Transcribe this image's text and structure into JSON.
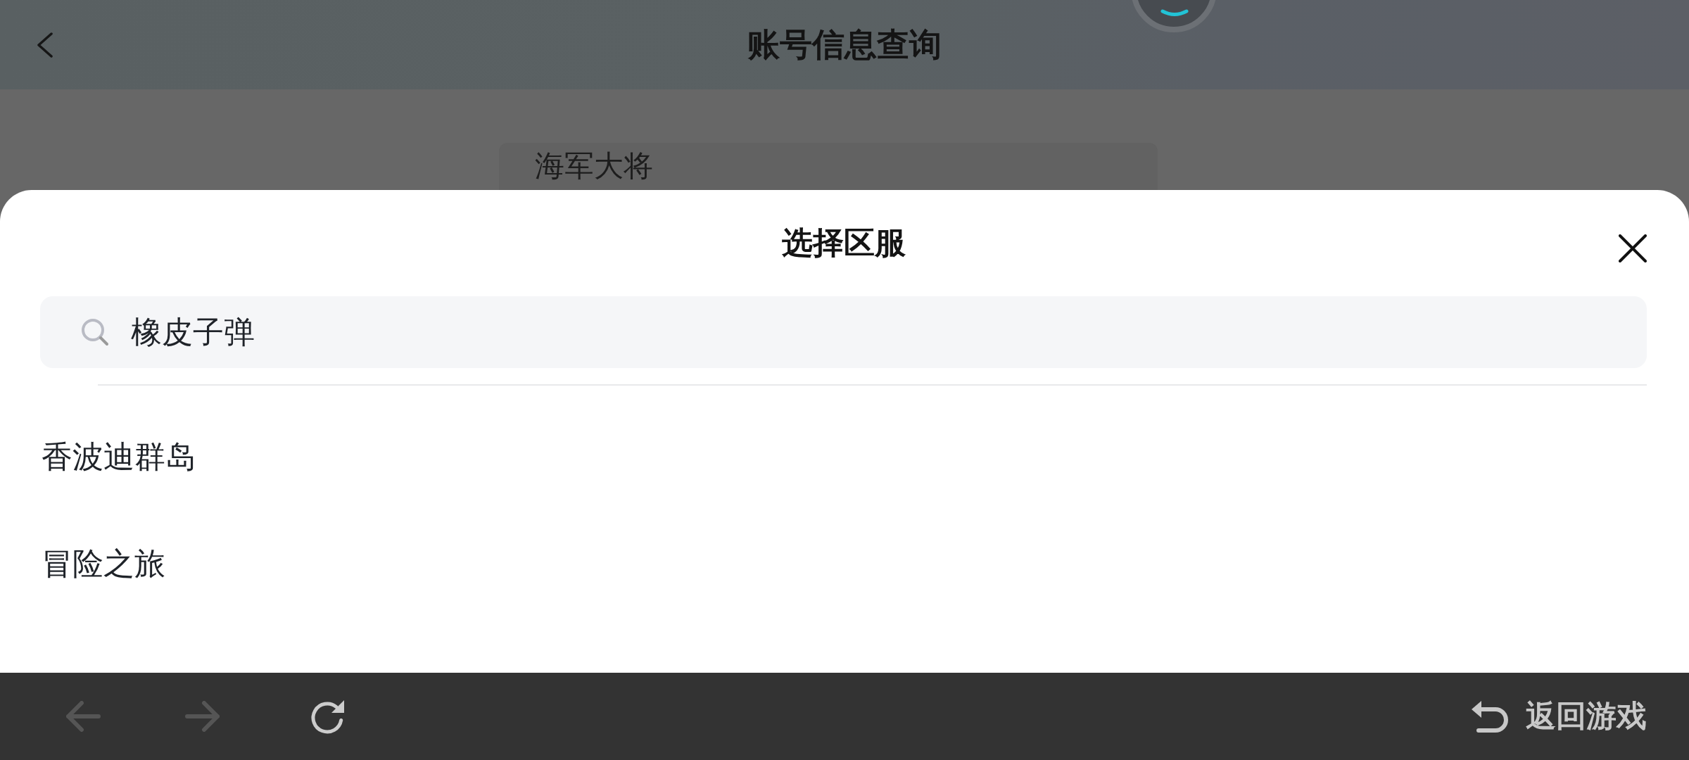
{
  "header": {
    "title": "账号信息查询"
  },
  "account_field": {
    "value": "海军大将"
  },
  "sheet": {
    "title": "选择区服",
    "search": {
      "value": "橡皮子弹"
    },
    "results": [
      "香波迪群岛",
      "冒险之旅"
    ]
  },
  "toolbar": {
    "buttons": [
      {
        "kind": "back",
        "disabled": true
      },
      {
        "kind": "forward",
        "disabled": true
      },
      {
        "kind": "refresh",
        "disabled": false
      }
    ],
    "return_button": {
      "label": "返回游戏"
    }
  }
}
